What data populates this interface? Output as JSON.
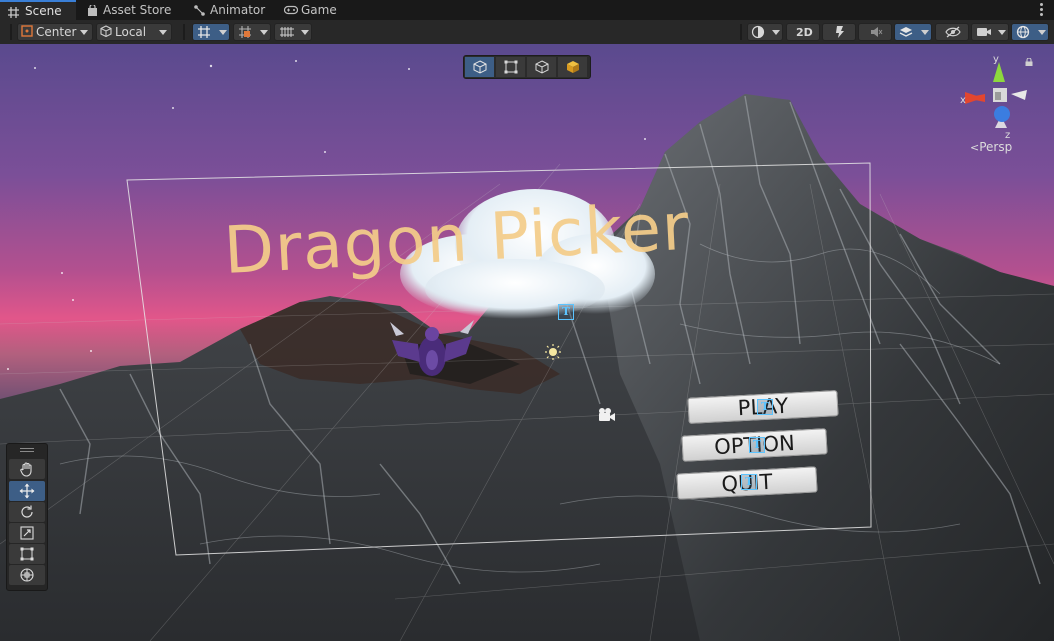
{
  "tabs": [
    {
      "label": "Scene",
      "icon": "grid-icon",
      "active": true
    },
    {
      "label": "Asset Store",
      "icon": "shopping-bag-icon",
      "active": false
    },
    {
      "label": "Animator",
      "icon": "animator-icon",
      "active": false
    },
    {
      "label": "Game",
      "icon": "gamepad-icon",
      "active": false
    }
  ],
  "toolbar": {
    "pivot_label": "Center",
    "space_label": "Local",
    "mode_2d_label": "2D"
  },
  "scene": {
    "title_text": "Dragon Picker",
    "buttons": [
      "PLAY",
      "OPTION",
      "QUIT"
    ],
    "text_gizmo_glyph": "T",
    "projection_label": "Persp",
    "axes": {
      "x": "x",
      "y": "y",
      "z": "z"
    }
  },
  "colors": {
    "accent": "#3a7fd6",
    "active_button": "#3d5e86",
    "title": "#f4cd8a",
    "text_gizmo": "#5cc4ff"
  }
}
